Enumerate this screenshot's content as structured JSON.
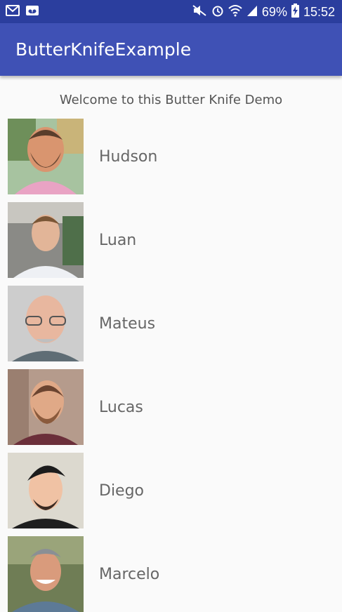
{
  "status_bar": {
    "battery": "69%",
    "time": "15:52",
    "icons": [
      "gmail-icon",
      "voicemail-icon",
      "mute-icon",
      "alarm-icon",
      "wifi-icon",
      "signal-icon",
      "battery-charging-icon"
    ]
  },
  "app_bar": {
    "title": "ButterKnifeExample",
    "color": "#3f51b5"
  },
  "welcome": "Welcome to this Butter Knife Demo",
  "people": [
    {
      "name": "Hudson"
    },
    {
      "name": "Luan"
    },
    {
      "name": "Mateus"
    },
    {
      "name": "Lucas"
    },
    {
      "name": "Diego"
    },
    {
      "name": "Marcelo"
    }
  ]
}
